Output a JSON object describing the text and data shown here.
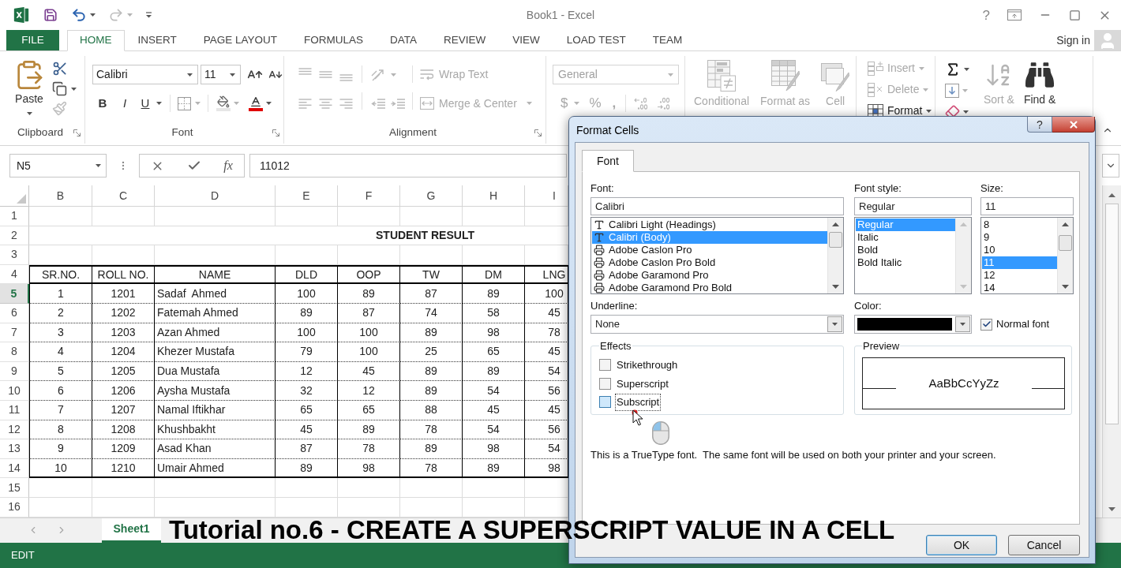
{
  "window": {
    "title": "Book1 - Excel",
    "help": "?"
  },
  "quick_access": {
    "redo_disabled": true
  },
  "file_tab": "FILE",
  "tabs": [
    {
      "label": "HOME",
      "selected": true
    },
    {
      "label": "INSERT",
      "selected": false
    },
    {
      "label": "PAGE LAYOUT",
      "selected": false
    },
    {
      "label": "FORMULAS",
      "selected": false
    },
    {
      "label": "DATA",
      "selected": false
    },
    {
      "label": "REVIEW",
      "selected": false
    },
    {
      "label": "VIEW",
      "selected": false
    },
    {
      "label": "LOAD TEST",
      "selected": false
    },
    {
      "label": "TEAM",
      "selected": false
    }
  ],
  "account": {
    "sign_in": "Sign in"
  },
  "ribbon": {
    "clipboard": {
      "label": "Clipboard",
      "paste": "Paste",
      "format_painter_disabled": true
    },
    "font": {
      "label": "Font",
      "font_name": "Calibri",
      "font_size": "11",
      "bold": "B",
      "italic": "I",
      "underline": "U"
    },
    "alignment": {
      "label": "Alignment",
      "disabled": true,
      "wrap_text": "Wrap Text",
      "merge_center": "Merge & Center"
    },
    "number": {
      "disabled": true,
      "format": "General",
      "currency": "$",
      "percent": "%",
      "comma": ","
    },
    "styles": {
      "disabled": true,
      "items": [
        "Conditional",
        "Format as",
        "Cell"
      ]
    },
    "cells": [
      {
        "label": "Insert",
        "disabled": true
      },
      {
        "label": "Delete",
        "disabled": true
      },
      {
        "label": "Format",
        "disabled": false
      }
    ],
    "editing": [
      {
        "label": "Sort &",
        "disabled": true
      },
      {
        "label": "Find &",
        "disabled": false
      }
    ]
  },
  "formula_bar": {
    "name_box": "N5",
    "function": "fx",
    "value": "11012"
  },
  "sheet": {
    "columns": [
      "B",
      "C",
      "D",
      "E",
      "F",
      "G",
      "H",
      "I"
    ],
    "rows": [
      {
        "number": "1",
        "selected": false,
        "kind": "blank"
      },
      {
        "number": "2",
        "selected": false,
        "kind": "title",
        "text": "STUDENT RESULT"
      },
      {
        "number": "3",
        "selected": false,
        "kind": "blank"
      },
      {
        "number": "4",
        "selected": false,
        "kind": "header",
        "cells": [
          "SR.NO.",
          "ROLL NO.",
          "NAME",
          "DLD",
          "OOP",
          "TW",
          "DM",
          "LNG"
        ]
      },
      {
        "number": "5",
        "selected": true,
        "kind": "record",
        "cells": [
          "1",
          "1201",
          "Sadaf  Ahmed",
          "100",
          "89",
          "87",
          "89",
          "100"
        ]
      },
      {
        "number": "6",
        "selected": false,
        "kind": "record",
        "cells": [
          "2",
          "1202",
          "Fatemah Ahmed",
          "89",
          "87",
          "74",
          "58",
          "45"
        ]
      },
      {
        "number": "7",
        "selected": false,
        "kind": "record",
        "cells": [
          "3",
          "1203",
          "Azan Ahmed",
          "100",
          "100",
          "89",
          "98",
          "78"
        ]
      },
      {
        "number": "8",
        "selected": false,
        "kind": "record",
        "cells": [
          "4",
          "1204",
          "Khezer Mustafa",
          "79",
          "100",
          "25",
          "65",
          "45"
        ]
      },
      {
        "number": "9",
        "selected": false,
        "kind": "record",
        "cells": [
          "5",
          "1205",
          "Dua Mustafa",
          "12",
          "45",
          "89",
          "89",
          "54"
        ]
      },
      {
        "number": "10",
        "selected": false,
        "kind": "record",
        "cells": [
          "6",
          "1206",
          "Aysha Mustafa",
          "32",
          "12",
          "89",
          "54",
          "56"
        ]
      },
      {
        "number": "11",
        "selected": false,
        "kind": "record",
        "cells": [
          "7",
          "1207",
          "Namal Iftikhar",
          "65",
          "65",
          "88",
          "45",
          "45"
        ]
      },
      {
        "number": "12",
        "selected": false,
        "kind": "record",
        "cells": [
          "8",
          "1208",
          "Khushbakht",
          "45",
          "89",
          "78",
          "54",
          "56"
        ]
      },
      {
        "number": "13",
        "selected": false,
        "kind": "record",
        "cells": [
          "9",
          "1209",
          "Asad Khan",
          "87",
          "78",
          "89",
          "98",
          "54"
        ]
      },
      {
        "number": "14",
        "selected": false,
        "kind": "record",
        "cells": [
          "10",
          "1210",
          "Umair Ahmed",
          "89",
          "98",
          "78",
          "89",
          "98"
        ]
      },
      {
        "number": "15",
        "selected": false,
        "kind": "blank"
      },
      {
        "number": "16",
        "selected": false,
        "kind": "blank"
      }
    ]
  },
  "sheet_tabs": [
    {
      "label": "Sheet1",
      "selected": true
    }
  ],
  "status_bar": {
    "mode": "EDIT"
  },
  "dialog": {
    "title": "Format Cells",
    "help": "?",
    "tabs": [
      {
        "label": "Font",
        "selected": true
      }
    ],
    "font": {
      "label": "Font:",
      "value": "Calibri",
      "items": [
        {
          "name": "Calibri Light (Headings)",
          "kind": "truetype",
          "selected": false
        },
        {
          "name": "Calibri (Body)",
          "kind": "truetype",
          "selected": true
        },
        {
          "name": "Adobe Caslon Pro",
          "kind": "printer",
          "selected": false
        },
        {
          "name": "Adobe Caslon Pro Bold",
          "kind": "printer",
          "selected": false
        },
        {
          "name": "Adobe Garamond Pro",
          "kind": "printer",
          "selected": false
        },
        {
          "name": "Adobe Garamond Pro Bold",
          "kind": "printer",
          "selected": false
        }
      ]
    },
    "font_style": {
      "label": "Font style:",
      "value": "Regular",
      "items": [
        {
          "name": "Regular",
          "selected": true
        },
        {
          "name": "Italic",
          "selected": false
        },
        {
          "name": "Bold",
          "selected": false
        },
        {
          "name": "Bold Italic",
          "selected": false
        }
      ]
    },
    "size": {
      "label": "Size:",
      "value": "11",
      "items": [
        {
          "name": "8",
          "selected": false
        },
        {
          "name": "9",
          "selected": false
        },
        {
          "name": "10",
          "selected": false
        },
        {
          "name": "11",
          "selected": true
        },
        {
          "name": "12",
          "selected": false
        },
        {
          "name": "14",
          "selected": false
        }
      ]
    },
    "underline": {
      "label": "Underline:",
      "value": "None"
    },
    "color": {
      "label": "Color:",
      "color": "#000000"
    },
    "normal_font": {
      "label": "Normal font",
      "checked": true
    },
    "effects": {
      "label": "Effects",
      "items": [
        {
          "label": "Strikethrough",
          "checked": false,
          "focused": false
        },
        {
          "label": "Superscript",
          "checked": false,
          "focused": false
        },
        {
          "label": "Subscript",
          "checked": false,
          "focused": true
        }
      ]
    },
    "preview": {
      "label": "Preview",
      "sample": "AaBbCcYyZz"
    },
    "note": "This is a TrueType font.  The same font will be used on both your printer and your screen.",
    "buttons": [
      {
        "label": "OK",
        "default": true
      },
      {
        "label": "Cancel",
        "default": false
      }
    ]
  },
  "caption": "Tutorial no.6 - CREATE A SUPERSCRIPT VALUE IN A CELL"
}
